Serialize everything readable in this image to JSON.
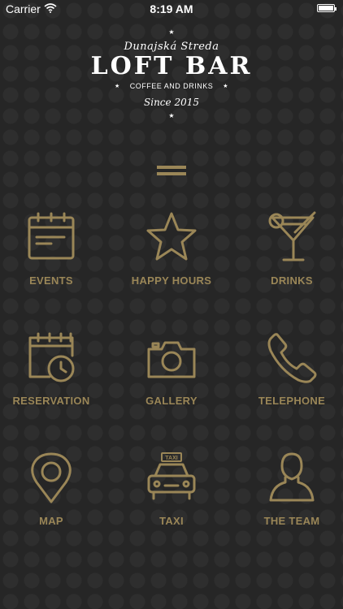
{
  "status": {
    "carrier": "Carrier",
    "time": "8:19 AM"
  },
  "logo": {
    "city": "Dunajská Streda",
    "name": "LOFT BAR",
    "tagline": "COFFEE AND DRINKS",
    "since": "Since 2015"
  },
  "menu": {
    "items": [
      {
        "label": "EVENTS",
        "icon": "calendar-icon"
      },
      {
        "label": "HAPPY HOURS",
        "icon": "star-icon"
      },
      {
        "label": "DRINKS",
        "icon": "cocktail-icon"
      },
      {
        "label": "RESERVATION",
        "icon": "calendar-clock-icon"
      },
      {
        "label": "GALLERY",
        "icon": "camera-icon"
      },
      {
        "label": "TELEPHONE",
        "icon": "phone-icon"
      },
      {
        "label": "MAP",
        "icon": "map-pin-icon"
      },
      {
        "label": "TAXI",
        "icon": "taxi-icon"
      },
      {
        "label": "THE TEAM",
        "icon": "person-icon"
      }
    ],
    "taxi_sign": "TAXI"
  },
  "colors": {
    "accent": "#9a8657",
    "background": "#262626",
    "text": "#ffffff"
  }
}
